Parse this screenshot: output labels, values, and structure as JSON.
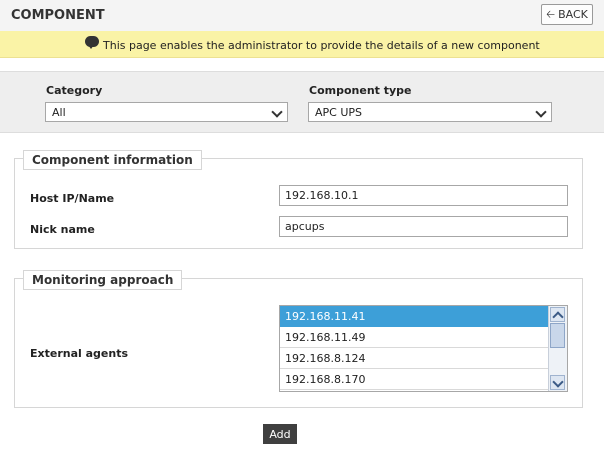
{
  "header": {
    "title": "COMPONENT",
    "back_label": "BACK"
  },
  "info": {
    "message": "This page enables the administrator to provide the details of a new component"
  },
  "filters": {
    "category_label": "Category",
    "category_value": "All",
    "component_type_label": "Component type",
    "component_type_value": "APC UPS"
  },
  "component_info": {
    "legend": "Component information",
    "host_label": "Host IP/Name",
    "host_value": "192.168.10.1",
    "nick_label": "Nick name",
    "nick_value": "apcups"
  },
  "monitoring": {
    "legend": "Monitoring approach",
    "agents_label": "External agents",
    "agents": [
      "192.168.11.41",
      "192.168.11.49",
      "192.168.8.124",
      "192.168.8.170"
    ],
    "selected_index": 0
  },
  "actions": {
    "add_label": "Add"
  },
  "colors": {
    "info_bar": "#faf3a6",
    "selection": "#3d9fd8",
    "add_button": "#3f3f3f"
  }
}
